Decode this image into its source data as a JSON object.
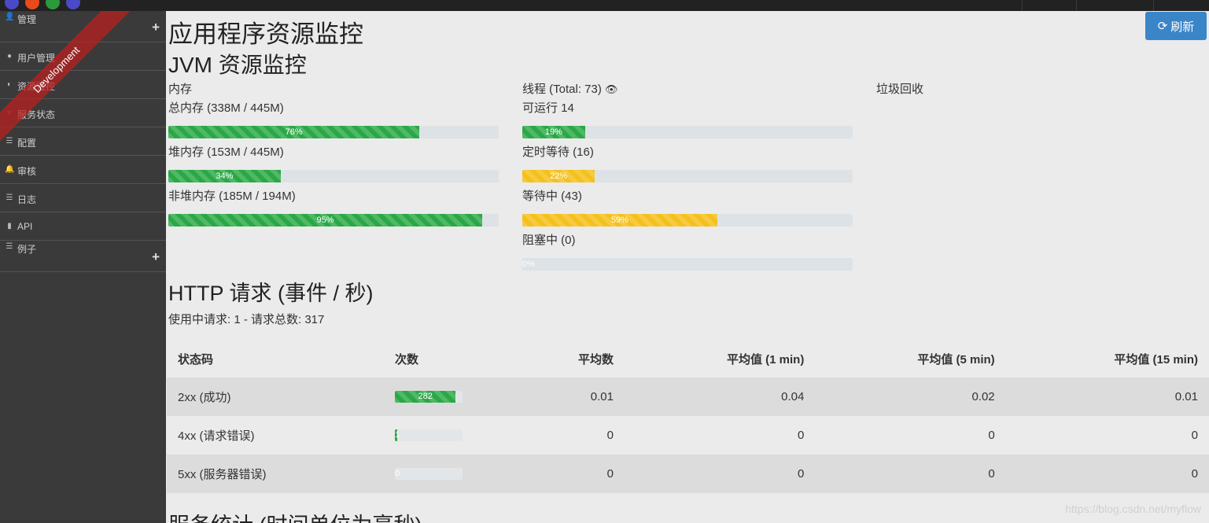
{
  "sidebar": {
    "ribbon": "Development",
    "items": [
      {
        "label": "管理",
        "icon": "user-plus-icon",
        "glyph": "👤"
      },
      {
        "label": "用户管理",
        "icon": "user-icon",
        "glyph": "●"
      },
      {
        "label": "资源监控",
        "icon": "dashboard-icon",
        "glyph": "◐"
      },
      {
        "label": "服务状态",
        "icon": "heart-icon",
        "glyph": "♥"
      },
      {
        "label": "配置",
        "icon": "list-icon",
        "glyph": "☰"
      },
      {
        "label": "审核",
        "icon": "bell-icon",
        "glyph": "🔔"
      },
      {
        "label": "日志",
        "icon": "tasks-icon",
        "glyph": "☰"
      },
      {
        "label": "API",
        "icon": "book-icon",
        "glyph": "▮"
      },
      {
        "label": "例子",
        "icon": "list-icon",
        "glyph": "☰"
      }
    ],
    "plus": "+"
  },
  "header": {
    "title": "应用程序资源监控",
    "refresh_label": "刷新",
    "refresh_glyph": "⟳"
  },
  "jvm": {
    "title": "JVM 资源监控",
    "memory": {
      "heading": "内存",
      "items": [
        {
          "label": "总内存 (338M / 445M)",
          "percent": 76,
          "text": "76%"
        },
        {
          "label": "堆内存 (153M / 445M)",
          "percent": 34,
          "text": "34%"
        },
        {
          "label": "非堆内存 (185M / 194M)",
          "percent": 95,
          "text": "95%"
        }
      ]
    },
    "threads": {
      "heading": "线程 (Total: 73)",
      "eye_glyph": "👁",
      "items": [
        {
          "label": "可运行 14",
          "percent": 19,
          "text": "19%",
          "color": "#2aa845"
        },
        {
          "label": "定时等待 (16)",
          "percent": 22,
          "text": "22%",
          "color": "#f4c01a"
        },
        {
          "label": "等待中 (43)",
          "percent": 59,
          "text": "59%",
          "color": "#f4c01a"
        },
        {
          "label": "阻塞中 (0)",
          "percent": 0,
          "text": "0%",
          "color": "#2aa845"
        }
      ]
    },
    "gc": {
      "heading": "垃圾回收"
    }
  },
  "http": {
    "title": "HTTP 请求 (事件 / 秒)",
    "summary": "使用中请求: 1 - 请求总数: 317",
    "columns": [
      "状态码",
      "次数",
      "平均数",
      "平均值 (1 min)",
      "平均值 (5 min)",
      "平均值 (15 min)"
    ],
    "rows": [
      {
        "code": "2xx (成功)",
        "count": 282,
        "count_text": "282",
        "fill": 0.9,
        "mean": "0.01",
        "m1": "0.04",
        "m5": "0.02",
        "m15": "0.01"
      },
      {
        "code": "4xx (请求错误)",
        "count": 1,
        "count_text": "1",
        "fill": 0.04,
        "mean": "0",
        "m1": "0",
        "m5": "0",
        "m15": "0"
      },
      {
        "code": "5xx (服务器错误)",
        "count": 0,
        "count_text": "0",
        "fill": 0,
        "mean": "0",
        "m1": "0",
        "m5": "0",
        "m15": "0"
      }
    ]
  },
  "services": {
    "title": "服务统计 (时间单位为毫秒)"
  },
  "watermark": "https://blog.csdn.net/myflow"
}
